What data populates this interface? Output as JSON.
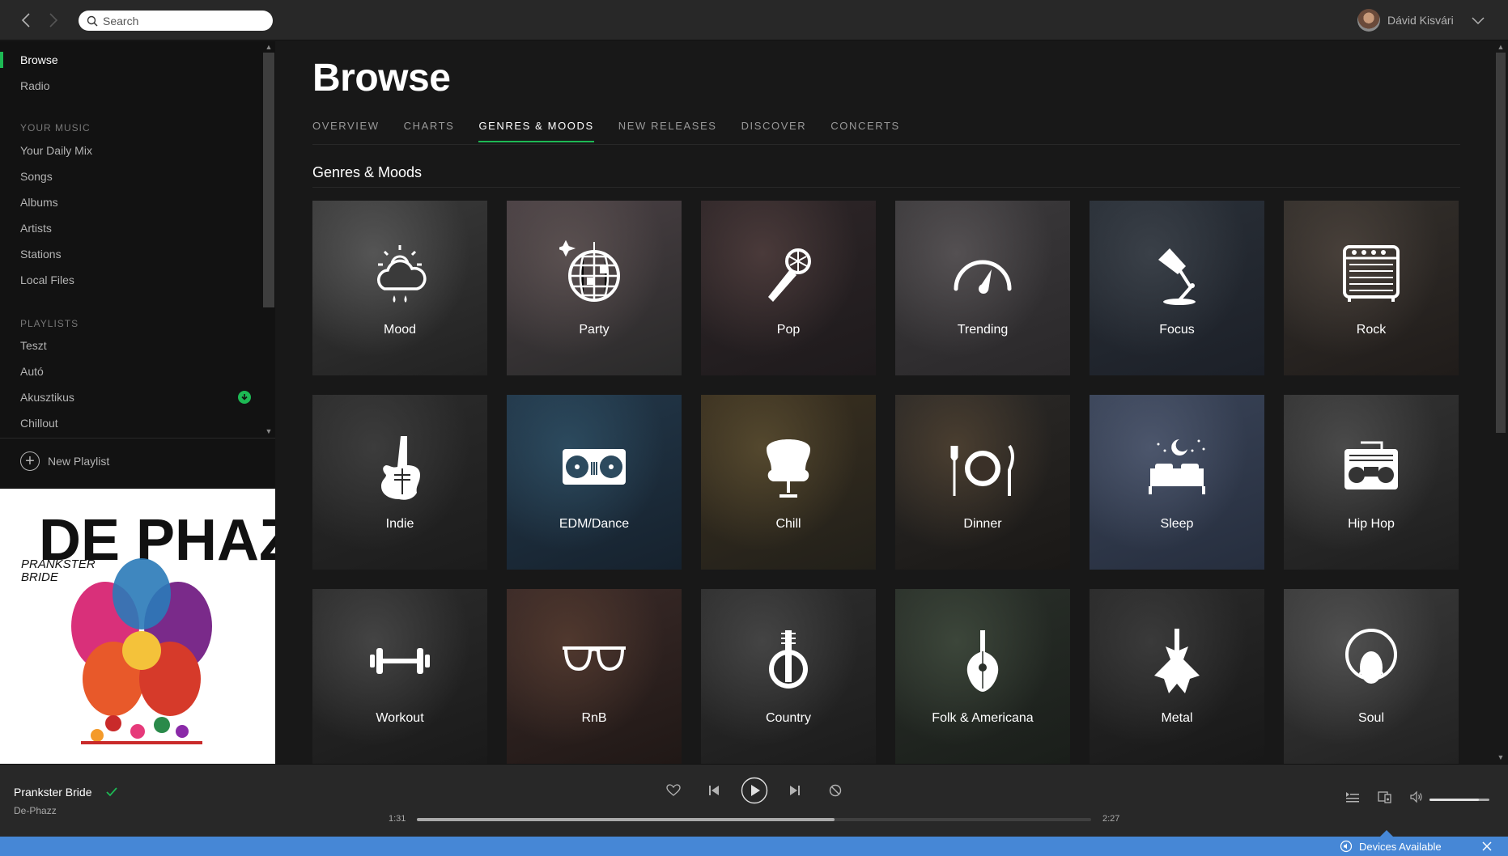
{
  "topbar": {
    "search_placeholder": "Search",
    "user_name": "Dávid Kisvári"
  },
  "sidebar": {
    "main_items": [
      {
        "label": "Browse",
        "active": true
      },
      {
        "label": "Radio",
        "active": false
      }
    ],
    "your_music_heading": "YOUR MUSIC",
    "your_music_items": [
      "Your Daily Mix",
      "Songs",
      "Albums",
      "Artists",
      "Stations",
      "Local Files"
    ],
    "playlists_heading": "PLAYLISTS",
    "playlists": [
      {
        "label": "Teszt",
        "downloaded": false
      },
      {
        "label": "Autó",
        "downloaded": false
      },
      {
        "label": "Akusztikus",
        "downloaded": true
      },
      {
        "label": "Chillout",
        "downloaded": false
      }
    ],
    "new_playlist_label": "New Playlist",
    "album_art": {
      "artist_logo": "DE PHAZZ",
      "album_name_line1": "PRANKSTER",
      "album_name_line2": "BRIDE"
    }
  },
  "main": {
    "title": "Browse",
    "tabs": [
      {
        "label": "OVERVIEW",
        "active": false
      },
      {
        "label": "CHARTS",
        "active": false
      },
      {
        "label": "GENRES & MOODS",
        "active": true
      },
      {
        "label": "NEW RELEASES",
        "active": false
      },
      {
        "label": "DISCOVER",
        "active": false
      },
      {
        "label": "CONCERTS",
        "active": false
      }
    ],
    "section_title": "Genres & Moods",
    "tiles": [
      {
        "label": "Mood",
        "icon": "weather-icon",
        "bg": [
          "#3a3a3a",
          "#555",
          "#222"
        ]
      },
      {
        "label": "Party",
        "icon": "disco-ball-icon",
        "bg": [
          "#4a4044",
          "#5a5050",
          "#2a2a2a"
        ]
      },
      {
        "label": "Pop",
        "icon": "microphone-icon",
        "bg": [
          "#2e2628",
          "#4a3a3a",
          "#1e1a1c"
        ]
      },
      {
        "label": "Trending",
        "icon": "gauge-icon",
        "bg": [
          "#3c3a3c",
          "#545052",
          "#2a282a"
        ]
      },
      {
        "label": "Focus",
        "icon": "desk-lamp-icon",
        "bg": [
          "#2a3038",
          "#3a4048",
          "#1c2028"
        ]
      },
      {
        "label": "Rock",
        "icon": "amplifier-icon",
        "bg": [
          "#34302c",
          "#48403a",
          "#201c1a"
        ]
      },
      {
        "label": "Indie",
        "icon": "electric-guitar-icon",
        "bg": [
          "#2c2c2c",
          "#3c3c3c",
          "#1c1c1c"
        ]
      },
      {
        "label": "EDM/Dance",
        "icon": "turntables-icon",
        "bg": [
          "#23384a",
          "#2c4a5e",
          "#16222e"
        ]
      },
      {
        "label": "Chill",
        "icon": "egg-chair-icon",
        "bg": [
          "#3a3020",
          "#54482e",
          "#22201a"
        ]
      },
      {
        "label": "Dinner",
        "icon": "plate-cutlery-icon",
        "bg": [
          "#2c2a28",
          "#4a3e30",
          "#1a1816"
        ]
      },
      {
        "label": "Sleep",
        "icon": "bed-moon-icon",
        "bg": [
          "#3a4458",
          "#4c566c",
          "#262e3e"
        ]
      },
      {
        "label": "Hip Hop",
        "icon": "boombox-icon",
        "bg": [
          "#343434",
          "#4a4a4a",
          "#1e1e1e"
        ]
      },
      {
        "label": "Workout",
        "icon": "dumbbell-icon",
        "bg": [
          "#2c2c2c",
          "#444",
          "#1a1a1a"
        ]
      },
      {
        "label": "RnB",
        "icon": "sunglasses-icon",
        "bg": [
          "#3a2a28",
          "#50382e",
          "#201816"
        ]
      },
      {
        "label": "Country",
        "icon": "banjo-icon",
        "bg": [
          "#2e2e2e",
          "#444",
          "#1c1c1c"
        ]
      },
      {
        "label": "Folk & Americana",
        "icon": "mandolin-icon",
        "bg": [
          "#2a302a",
          "#3c463a",
          "#1a1e1a"
        ]
      },
      {
        "label": "Metal",
        "icon": "metal-guitar-icon",
        "bg": [
          "#2a2a2a",
          "#3a3a3a",
          "#181818"
        ]
      },
      {
        "label": "Soul",
        "icon": "afro-face-icon",
        "bg": [
          "#3a3a3a",
          "#505050",
          "#222"
        ]
      }
    ]
  },
  "player": {
    "track_title": "Prankster Bride",
    "track_artist": "De-Phazz",
    "elapsed": "1:31",
    "duration": "2:27",
    "progress_fraction": 0.62,
    "volume_fraction": 0.82
  },
  "devices_bar": {
    "label": "Devices Available"
  },
  "colors": {
    "accent": "#1db954",
    "devices_blue": "#4687d6"
  }
}
